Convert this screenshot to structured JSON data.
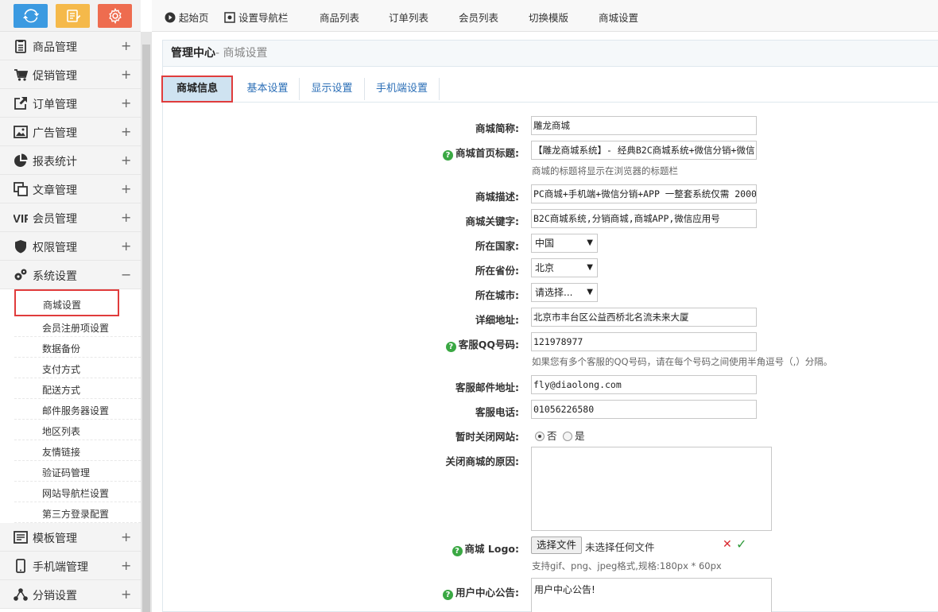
{
  "colors": {
    "refresh": "#3b9ae1",
    "note": "#f5b94a",
    "gear": "#ee6c4f",
    "active_border": "#e03c3c",
    "help": "#3aa843"
  },
  "toolbox": [
    {
      "icon": "refresh-icon",
      "color": "#3b9ae1"
    },
    {
      "icon": "edit-note-icon",
      "color": "#f5b94a"
    },
    {
      "icon": "gear-icon",
      "color": "#ee6c4f"
    }
  ],
  "sidebar": {
    "groups": [
      {
        "label": "商品管理",
        "icon": "clipboard-icon",
        "toggle": "+"
      },
      {
        "label": "促销管理",
        "icon": "cart-icon",
        "toggle": "+"
      },
      {
        "label": "订单管理",
        "icon": "external-link-icon",
        "toggle": "+"
      },
      {
        "label": "广告管理",
        "icon": "image-icon",
        "toggle": "+"
      },
      {
        "label": "报表统计",
        "icon": "pie-chart-icon",
        "toggle": "+"
      },
      {
        "label": "文章管理",
        "icon": "copy-icon",
        "toggle": "+"
      },
      {
        "label": "会员管理",
        "icon": "vip-icon",
        "toggle": "+"
      },
      {
        "label": "权限管理",
        "icon": "shield-icon",
        "toggle": "+"
      },
      {
        "label": "系统设置",
        "icon": "gears-icon",
        "toggle": "−"
      }
    ],
    "sub_items": [
      "商城设置",
      "会员注册项设置",
      "数据备份",
      "支付方式",
      "配送方式",
      "邮件服务器设置",
      "地区列表",
      "友情链接",
      "验证码管理",
      "网站导航栏设置",
      "第三方登录配置"
    ],
    "groups_after": [
      {
        "label": "模板管理",
        "icon": "template-icon",
        "toggle": "+"
      },
      {
        "label": "手机端管理",
        "icon": "mobile-icon",
        "toggle": "+"
      },
      {
        "label": "分销设置",
        "icon": "share-icon",
        "toggle": "+"
      }
    ]
  },
  "topnav": {
    "items": [
      {
        "label": "起始页",
        "icon": "play-icon"
      },
      {
        "label": "设置导航栏",
        "icon": "settings-icon"
      },
      {
        "label": "商品列表"
      },
      {
        "label": "订单列表"
      },
      {
        "label": "会员列表"
      },
      {
        "label": "切换模版"
      },
      {
        "label": "商城设置"
      }
    ]
  },
  "panel": {
    "title": "管理中心",
    "subtitle": "- 商城设置"
  },
  "tabs": [
    "商城信息",
    "基本设置",
    "显示设置",
    "手机端设置"
  ],
  "form": {
    "shop_name": {
      "label": "商城简称:",
      "value": "雕龙商城"
    },
    "home_title": {
      "label": "商城首页标题:",
      "value": "【雕龙商城系统】- 经典B2C商城系统+微信分销+微信",
      "hint": "商城的标题将显示在浏览器的标题栏"
    },
    "description": {
      "label": "商城描述:",
      "value": "PC商城+手机端+微信分销+APP 一整套系统仅需 2000"
    },
    "keywords": {
      "label": "商城关键字:",
      "value": "B2C商城系统,分销商城,商城APP,微信应用号"
    },
    "country": {
      "label": "所在国家:",
      "value": "中国"
    },
    "province": {
      "label": "所在省份:",
      "value": "北京"
    },
    "city": {
      "label": "所在城市:",
      "value": "请选择..."
    },
    "address": {
      "label": "详细地址:",
      "value": "北京市丰台区公益西桥北名流未来大厦"
    },
    "qq": {
      "label": "客服QQ号码:",
      "value": "121978977",
      "hint": "如果您有多个客服的QQ号码，请在每个号码之间使用半角逗号（,）分隔。"
    },
    "email": {
      "label": "客服邮件地址:",
      "value": "fly@diaolong.com"
    },
    "phone": {
      "label": "客服电话:",
      "value": "01056226580"
    },
    "close_site": {
      "label": "暂时关闭网站:",
      "options": [
        "否",
        "是"
      ],
      "selected": "否"
    },
    "close_reason": {
      "label": "关闭商城的原因:",
      "value": ""
    },
    "logo": {
      "label": "商城 Logo:",
      "button": "选择文件",
      "status": "未选择任何文件",
      "delete": "✕",
      "ok": "✓",
      "hint": "支持gif、png、jpeg格式,规格:180px * 60px"
    },
    "user_notice": {
      "label": "用户中心公告:",
      "value": "用户中心公告!"
    }
  }
}
